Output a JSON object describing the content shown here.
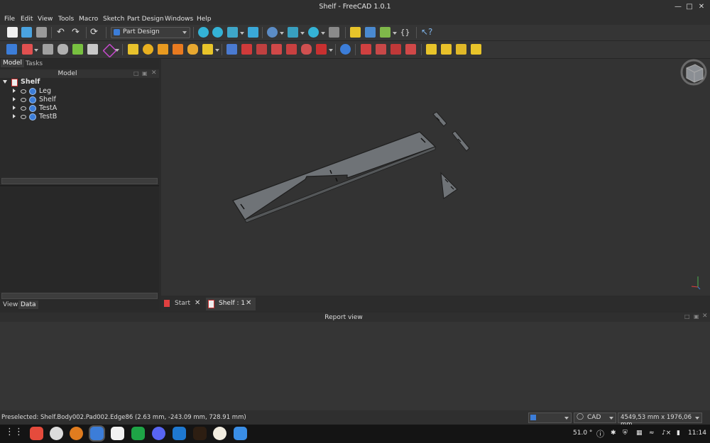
{
  "window": {
    "title": "Shelf - FreeCAD 1.0.1"
  },
  "menu": [
    "File",
    "Edit",
    "View",
    "Tools",
    "Macro",
    "Sketch",
    "Part Design",
    "Windows",
    "Help"
  ],
  "workbench": {
    "selected": "Part Design"
  },
  "panel": {
    "tabs": [
      "Model",
      "Tasks"
    ],
    "title": "Model",
    "tree": {
      "root": "Shelf",
      "children": [
        "Leg",
        "Shelf",
        "TestA",
        "TestB"
      ]
    },
    "bottom_tabs": [
      "View",
      "Data"
    ]
  },
  "doc_tabs": [
    "Start",
    "Shelf : 1"
  ],
  "report": {
    "title": "Report view"
  },
  "status": {
    "preselected": "Preselected: Shelf.Body002.Pad002.Edge86 (2.63 mm, -243.09 mm, 728.91 mm)",
    "nav_style": "CAD",
    "dimensions": "4549,53 mm x 1976,06 mm"
  },
  "taskbar": {
    "apps": [
      "app-launcher",
      "vivaldi-browser",
      "inkscape",
      "blender",
      "freecad",
      "app-orange",
      "libreoffice-calc",
      "discord",
      "vscode",
      "terminal",
      "kicad",
      "files"
    ],
    "temperature": "51.0 °",
    "clock": "11:14"
  },
  "colors": {
    "accent": "#3c7dd8",
    "viewport": "#333333",
    "part": "#6f7377"
  }
}
